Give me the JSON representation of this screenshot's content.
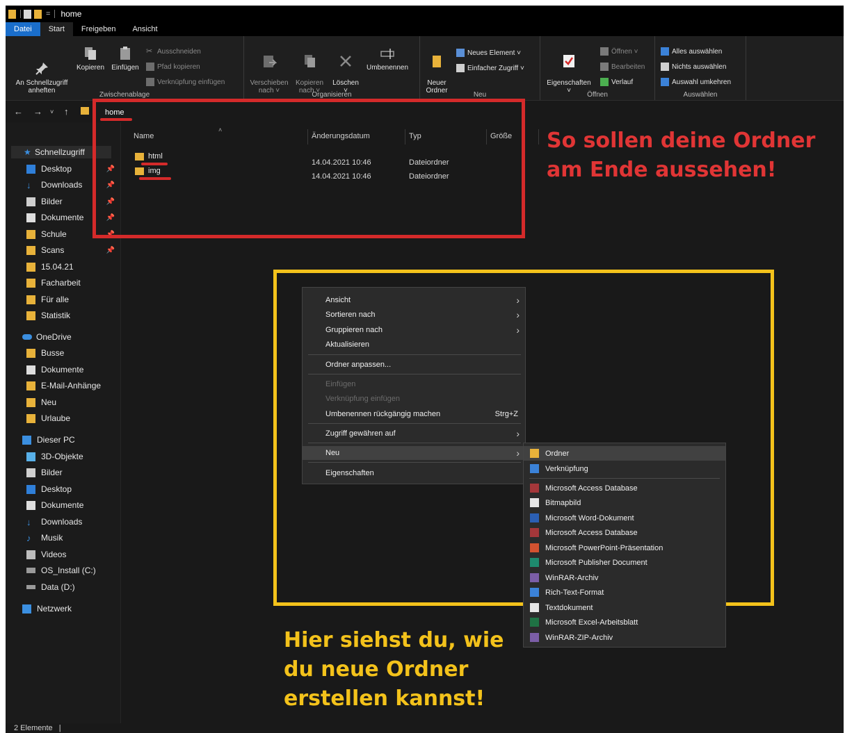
{
  "window": {
    "title": "home"
  },
  "tabs": [
    "Datei",
    "Start",
    "Freigeben",
    "Ansicht"
  ],
  "ribbon": {
    "clipboard": {
      "pin": "An Schnellzugriff\nanheften",
      "copy": "Kopieren",
      "paste": "Einfügen",
      "cut": "Ausschneiden",
      "copy_path": "Pfad kopieren",
      "paste_shortcut": "Verknüpfung einfügen",
      "title": "Zwischenablage"
    },
    "organize": {
      "move": "Verschieben\nnach ˅",
      "copy_to": "Kopieren\nnach ˅",
      "delete": "Löschen\n˅",
      "rename": "Umbenennen",
      "title": "Organisieren"
    },
    "new": {
      "new_folder": "Neuer\nOrdner",
      "new_item": "Neues Element ˅",
      "easy_access": "Einfacher Zugriff ˅",
      "title": "Neu"
    },
    "open": {
      "properties": "Eigenschaften\n˅",
      "open": "Öffnen ˅",
      "edit": "Bearbeiten",
      "history": "Verlauf",
      "title": "Öffnen"
    },
    "select": {
      "select_all": "Alles auswählen",
      "select_none": "Nichts auswählen",
      "invert": "Auswahl umkehren",
      "title": "Auswählen"
    }
  },
  "address": {
    "path": "home"
  },
  "nav": {
    "quick_access": "Schnellzugriff",
    "quick_items": [
      "Desktop",
      "Downloads",
      "Bilder",
      "Dokumente",
      "Schule",
      "Scans",
      "15.04.21",
      "Facharbeit",
      "Für alle",
      "Statistik"
    ],
    "onedrive": "OneDrive",
    "onedrive_items": [
      "Busse",
      "Dokumente",
      "E-Mail-Anhänge",
      "Neu",
      "Urlaube"
    ],
    "this_pc": "Dieser PC",
    "pc_items": [
      "3D-Objekte",
      "Bilder",
      "Desktop",
      "Dokumente",
      "Downloads",
      "Musik",
      "Videos",
      "OS_Install (C:)",
      "Data (D:)"
    ],
    "network": "Netzwerk"
  },
  "columns": {
    "name": "Name",
    "date": "Änderungsdatum",
    "type": "Typ",
    "size": "Größe"
  },
  "files": [
    {
      "name": "html",
      "date": "14.04.2021 10:46",
      "type": "Dateiordner"
    },
    {
      "name": "img",
      "date": "14.04.2021 10:46",
      "type": "Dateiordner"
    }
  ],
  "status": {
    "count": "2 Elemente"
  },
  "context_menu": {
    "view": "Ansicht",
    "sort": "Sortieren nach",
    "group": "Gruppieren nach",
    "refresh": "Aktualisieren",
    "customize": "Ordner anpassen...",
    "paste": "Einfügen",
    "paste_shortcut": "Verknüpfung einfügen",
    "undo": "Umbenennen rückgängig machen",
    "undo_shortcut": "Strg+Z",
    "grant_access": "Zugriff gewähren auf",
    "new": "Neu",
    "properties": "Eigenschaften"
  },
  "submenu": [
    {
      "label": "Ordner",
      "icon": "folder-icon"
    },
    {
      "label": "Verknüpfung",
      "icon": "shortcut-icon"
    },
    {
      "label": "Microsoft Access Database",
      "icon": "access-icon"
    },
    {
      "label": "Bitmapbild",
      "icon": "bitmap-icon"
    },
    {
      "label": "Microsoft Word-Dokument",
      "icon": "word-icon"
    },
    {
      "label": "Microsoft Access Database",
      "icon": "access-icon"
    },
    {
      "label": "Microsoft PowerPoint-Präsentation",
      "icon": "powerpoint-icon"
    },
    {
      "label": "Microsoft Publisher Document",
      "icon": "publisher-icon"
    },
    {
      "label": "WinRAR-Archiv",
      "icon": "winrar-icon"
    },
    {
      "label": "Rich-Text-Format",
      "icon": "rtf-icon"
    },
    {
      "label": "Textdokument",
      "icon": "text-icon"
    },
    {
      "label": "Microsoft Excel-Arbeitsblatt",
      "icon": "excel-icon"
    },
    {
      "label": "WinRAR-ZIP-Archiv",
      "icon": "winrar-zip-icon"
    }
  ],
  "annotations": {
    "red": "So sollen deine Ordner\nam Ende aussehen!",
    "yellow": "Hier siehst du, wie\ndu neue Ordner\nerstellen kannst!"
  },
  "colors": {
    "accent": "#1a6ecb",
    "folder": "#e8b23a",
    "annotation_red": "#d42a2a",
    "annotation_yellow": "#f3c21b"
  }
}
